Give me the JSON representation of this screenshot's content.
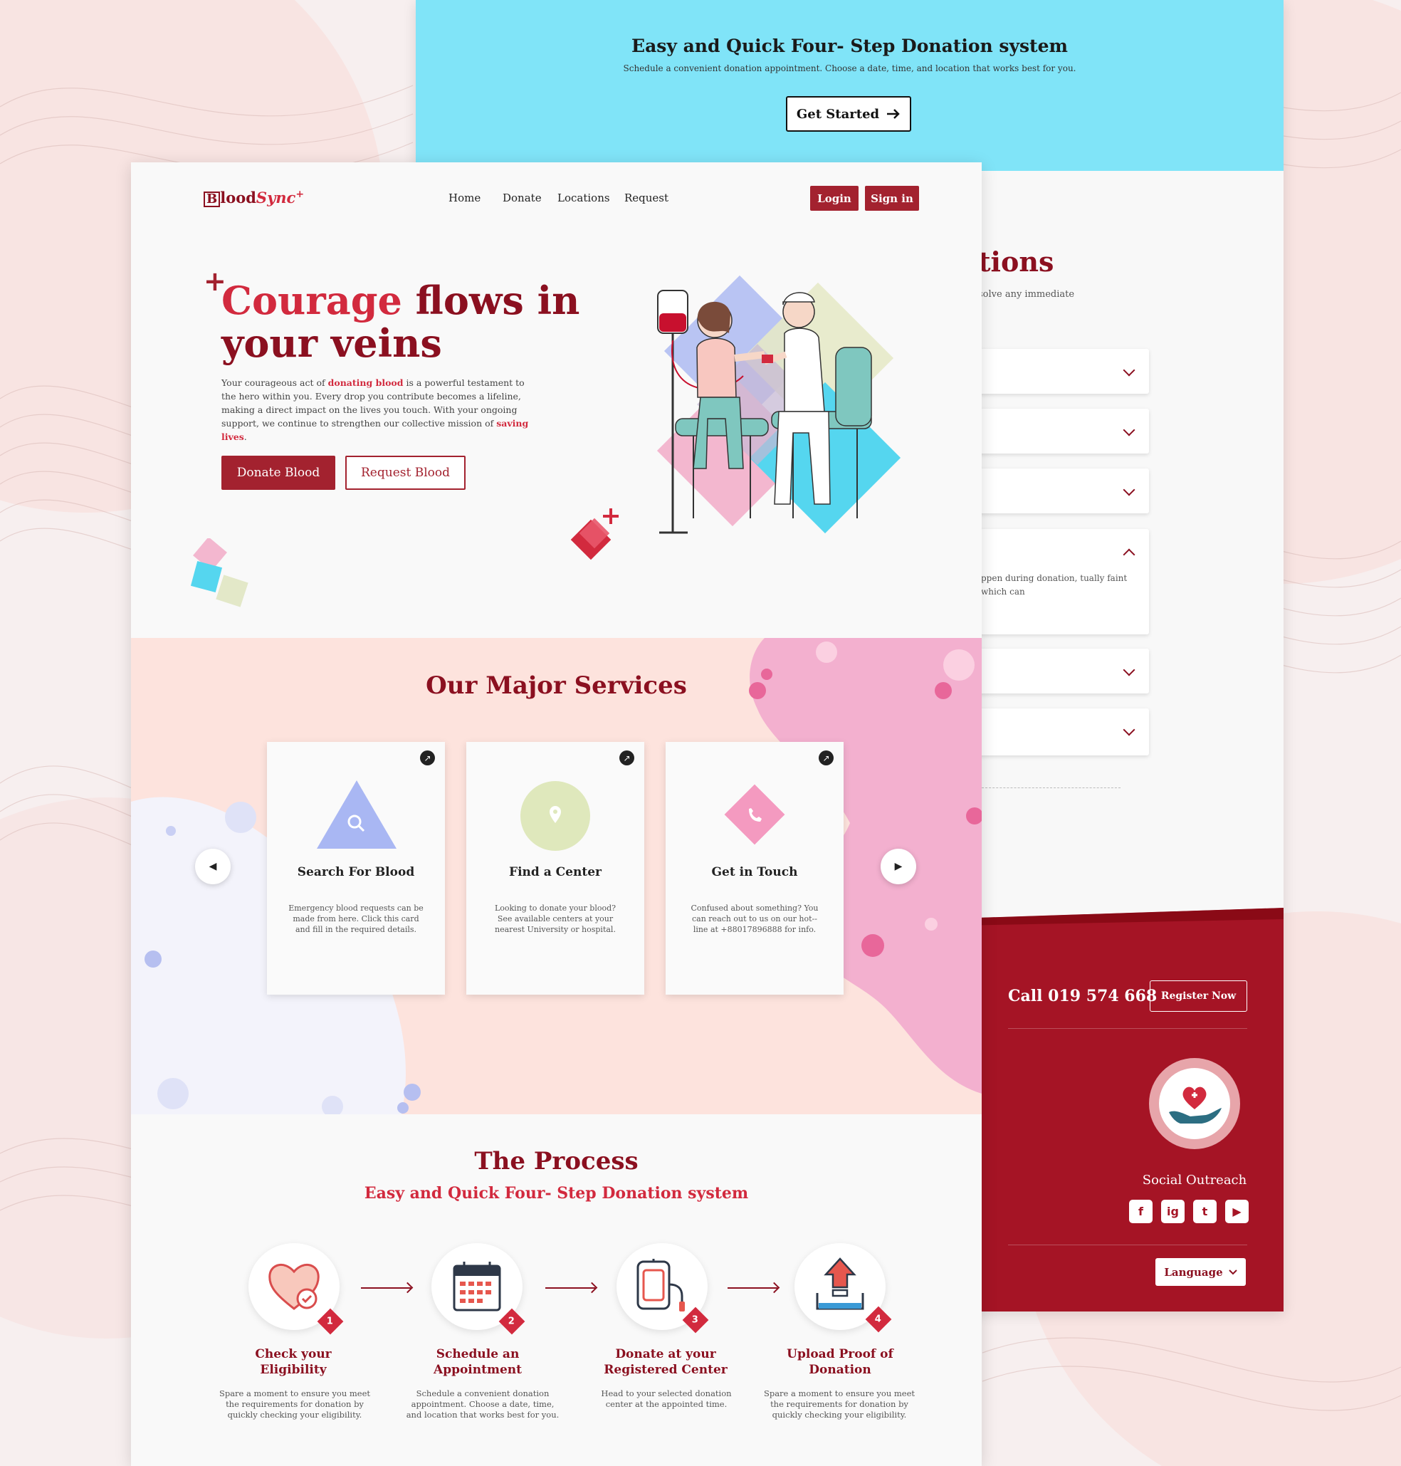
{
  "brand": {
    "logo_b": "B",
    "logo_lood": "lood",
    "logo_sync": "Sync",
    "logo_plus": "+"
  },
  "nav": {
    "home": "Home",
    "donate": "Donate",
    "locations": "Locations",
    "request": "Request",
    "login": "Login",
    "signin": "Sign in"
  },
  "hero": {
    "plus": "+",
    "title_accent": "Courage",
    "title_rest": " flows in your veins",
    "p1": "Your courageous act of ",
    "hl1": "donating blood",
    "p2": " is a powerful testament to the hero within you. Every drop you contribute becomes a lifeline, making a direct impact on the lives you touch. With your ongoing support, we continue to strengthen our collective mission of ",
    "hl2": "saving lives",
    "p3": ".",
    "donate_btn": "Donate Blood",
    "request_btn": "Request Blood"
  },
  "services": {
    "title": "Our Major Services",
    "cards": [
      {
        "title": "Search For Blood",
        "desc": "Emergency blood requests can be made from here. Click this card and fill in the required details.",
        "icon": "search-icon"
      },
      {
        "title": "Find a Center",
        "desc": "Looking to donate your blood? See available centers at your nearest University or hospital.",
        "icon": "location-pin-icon"
      },
      {
        "title": "Get in Touch",
        "desc": "Confused about something? You can reach out to us on our hot--line at +88017896888 for info.",
        "icon": "phone-icon"
      }
    ],
    "prev_icon": "◀",
    "next_icon": "▶",
    "open_icon": "↗"
  },
  "process": {
    "title": "The Process",
    "subtitle": "Easy and Quick Four- Step Donation system",
    "steps": [
      {
        "num": "1",
        "title": "Check your Eligibility",
        "desc": "Spare a moment to ensure you meet the requirements for donation by quickly checking your eligibility.",
        "icon": "heart-check-icon"
      },
      {
        "num": "2",
        "title": "Schedule an Appointment",
        "desc": "Schedule a convenient donation appointment. Choose a date, time, and location that works best for you.",
        "icon": "calendar-icon"
      },
      {
        "num": "3",
        "title": "Donate at your Registered Center",
        "desc": "Head to your selected donation center at the appointed time.",
        "icon": "blood-bag-icon"
      },
      {
        "num": "4",
        "title": "Upload Proof of Donation",
        "desc": "Spare a moment to ensure you meet the requirements for donation by quickly checking your eligibility.",
        "icon": "upload-icon"
      }
    ]
  },
  "back_page": {
    "banner_title": "Easy and Quick Four- Step Donation system",
    "banner_sub": "Schedule a convenient donation appointment. Choose a date, time, and location that works best for you.",
    "get_started": "Get Started",
    "faq_title_fragment": "tions",
    "faq_sub_fragment": "solve any immediate",
    "faq_open_text": "ppen during donation, tually faint which can",
    "call": "Call 019 574 668",
    "register": "Register Now",
    "social_title": "Social Outreach",
    "social": [
      "f",
      "ig",
      "t",
      "▶"
    ],
    "language": "Language"
  },
  "colors": {
    "brand": "#8b1020",
    "accent": "#d22a3e",
    "button": "#a3222f",
    "banner": "#80e4f8",
    "footer": "#a51425"
  }
}
